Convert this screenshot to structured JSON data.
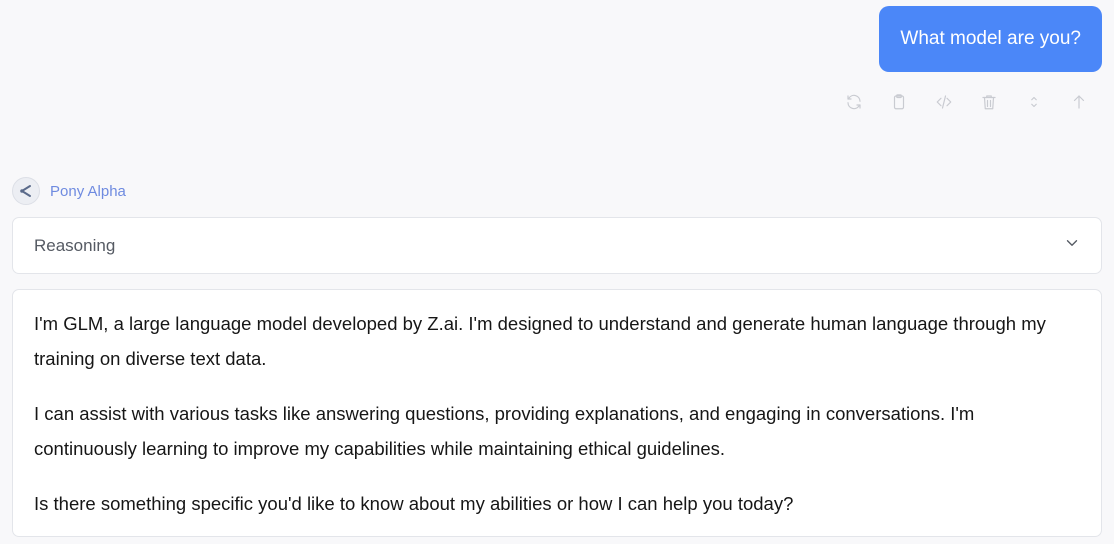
{
  "user_message": {
    "text": "What model are you?"
  },
  "toolbar": {
    "icons": [
      "refresh-icon",
      "clipboard-icon",
      "code-icon",
      "trash-icon",
      "expand-icon",
      "arrow-up-icon"
    ]
  },
  "assistant": {
    "model_name": "Pony Alpha",
    "reasoning_label": "Reasoning",
    "paragraphs": [
      "I'm GLM, a large language model developed by Z.ai. I'm designed to understand and generate human language through my training on diverse text data.",
      "I can assist with various tasks like answering questions, providing explanations, and engaging in conversations. I'm continuously learning to improve my capabilities while maintaining ethical guidelines.",
      "Is there something specific you'd like to know about my abilities or how I can help you today?"
    ]
  },
  "colors": {
    "user_bubble": "#4b87f8",
    "model_name": "#6f8be0",
    "background": "#f8f8fa"
  }
}
